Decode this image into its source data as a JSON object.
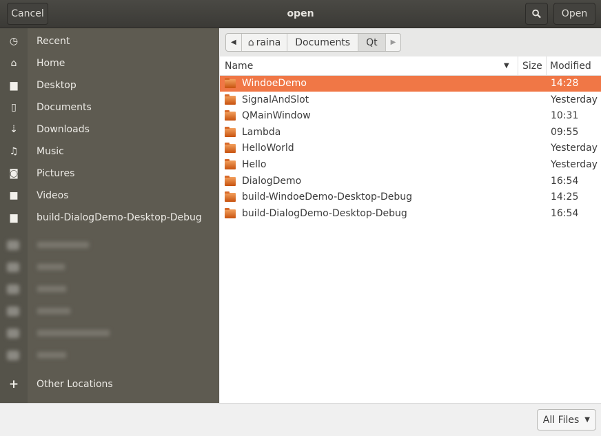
{
  "header": {
    "cancel": "Cancel",
    "title": "open",
    "open": "Open",
    "search_icon": "search-icon"
  },
  "sidebar": {
    "items": [
      {
        "label": "Recent",
        "icon": "clock-icon"
      },
      {
        "label": "Home",
        "icon": "home-icon"
      },
      {
        "label": "Desktop",
        "icon": "folder-icon"
      },
      {
        "label": "Documents",
        "icon": "document-icon"
      },
      {
        "label": "Downloads",
        "icon": "download-icon"
      },
      {
        "label": "Music",
        "icon": "music-icon"
      },
      {
        "label": "Pictures",
        "icon": "camera-icon"
      },
      {
        "label": "Videos",
        "icon": "video-icon"
      },
      {
        "label": "build-DialogDemo-Desktop-Debug",
        "icon": "folder-icon"
      }
    ],
    "other_locations": "Other Locations"
  },
  "breadcrumb": [
    "raina",
    "Documents",
    "Qt"
  ],
  "columns": {
    "name": "Name",
    "size": "Size",
    "modified": "Modified"
  },
  "files": [
    {
      "name": "WindoeDemo",
      "modified": "14:28",
      "selected": true
    },
    {
      "name": "SignalAndSlot",
      "modified": "Yesterday"
    },
    {
      "name": "QMainWindow",
      "modified": "10:31"
    },
    {
      "name": "Lambda",
      "modified": "09:55"
    },
    {
      "name": "HelloWorld",
      "modified": "Yesterday"
    },
    {
      "name": "Hello",
      "modified": "Yesterday"
    },
    {
      "name": "DialogDemo",
      "modified": "16:54"
    },
    {
      "name": "build-WindoeDemo-Desktop-Debug",
      "modified": "14:25"
    },
    {
      "name": "build-DialogDemo-Desktop-Debug",
      "modified": "16:54"
    }
  ],
  "filter": "All Files",
  "colors": {
    "selection": "#f07746",
    "sidebar": "#5e5b51",
    "header": "#3b3a36"
  }
}
